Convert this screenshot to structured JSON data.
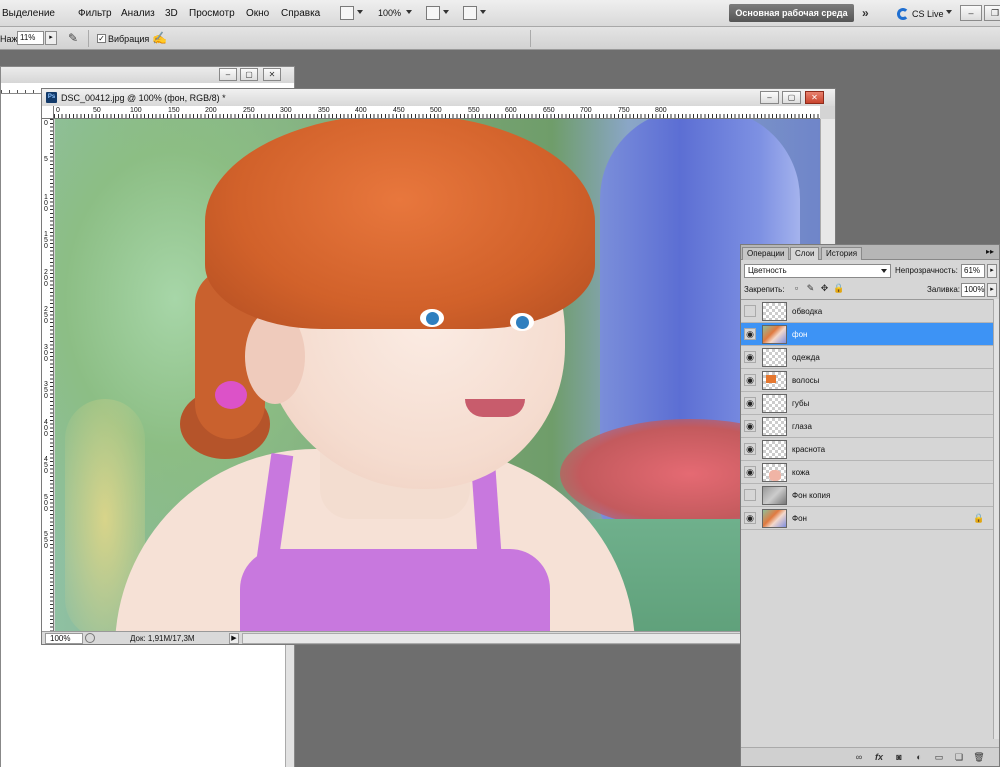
{
  "menu": {
    "items": [
      "Выделение",
      "Фильтр",
      "Анализ",
      "3D",
      "Просмотр",
      "Окно",
      "Справка"
    ],
    "zoom": "100%",
    "workspace": "Основная рабочая среда",
    "cslive": "CS Live"
  },
  "options": {
    "label": "Нажим:",
    "value": "11%",
    "vibration_label": "Вибрация",
    "vibration_checked": true
  },
  "document": {
    "title": "DSC_00412.jpg @ 100% (фон, RGB/8) *",
    "ruler_top": [
      "0",
      "50",
      "100",
      "150",
      "200",
      "250",
      "300",
      "350",
      "400",
      "450",
      "500",
      "550",
      "600",
      "650",
      "700",
      "750",
      "800"
    ],
    "ruler_left": [
      "0",
      "5",
      "1\n0\n0",
      "1\n5\n0",
      "2\n0\n0",
      "2\n5\n0",
      "3\n0\n0",
      "3\n5\n0",
      "4\n0\n0",
      "4\n5\n0",
      "5\n0\n0",
      "5\n5\n0"
    ],
    "zoom": "100%",
    "doc_info": "Док: 1,91M/17,3M"
  },
  "layers_panel": {
    "tabs": [
      "Операции",
      "Слои",
      "История"
    ],
    "active_tab": "Слои",
    "blend_mode": "Цветность",
    "opacity_label": "Непрозрачность:",
    "opacity_value": "61%",
    "lock_label": "Закрепить:",
    "fill_label": "Заливка:",
    "fill_value": "100%",
    "layers": [
      {
        "name": "обводка",
        "visible": false,
        "thumb": "transparent",
        "selected": false
      },
      {
        "name": "фон",
        "visible": true,
        "thumb": "photo",
        "selected": true
      },
      {
        "name": "одежда",
        "visible": true,
        "thumb": "transparent",
        "selected": false
      },
      {
        "name": "волосы",
        "visible": true,
        "thumb": "orange",
        "selected": false
      },
      {
        "name": "губы",
        "visible": true,
        "thumb": "transparent",
        "selected": false
      },
      {
        "name": "глаза",
        "visible": true,
        "thumb": "transparent",
        "selected": false
      },
      {
        "name": "краснота",
        "visible": true,
        "thumb": "transparent",
        "selected": false
      },
      {
        "name": "кожа",
        "visible": true,
        "thumb": "pink",
        "selected": false
      },
      {
        "name": "Фон копия",
        "visible": false,
        "thumb": "grey",
        "selected": false
      },
      {
        "name": "Фон",
        "visible": true,
        "thumb": "photo",
        "selected": false,
        "locked": true
      }
    ]
  }
}
